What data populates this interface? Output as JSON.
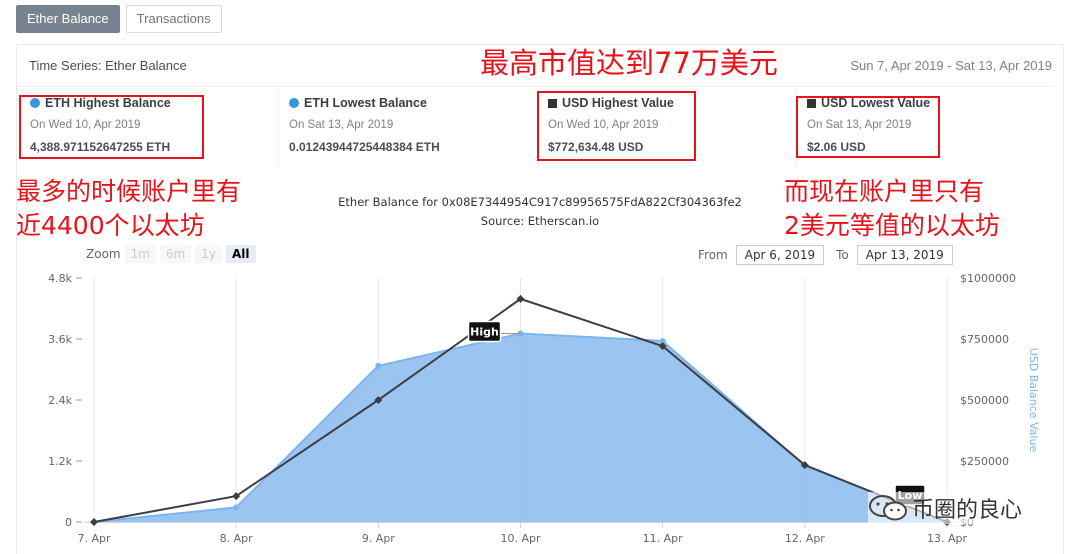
{
  "tabs": [
    {
      "label": "Ether Balance",
      "active": true
    },
    {
      "label": "Transactions",
      "active": false
    }
  ],
  "header": {
    "title": "Time Series: Ether Balance",
    "date_range": "Sun 7, Apr 2019 - Sat 13, Apr 2019"
  },
  "stats": [
    {
      "title": "ETH Highest Balance",
      "date": "On Wed 10, Apr 2019",
      "value": "4,388.971152647255 ETH",
      "marker": "dot"
    },
    {
      "title": "ETH Lowest Balance",
      "date": "On Sat 13, Apr 2019",
      "value": "0.01243944725448384 ETH",
      "marker": "dot"
    },
    {
      "title": "USD Highest Value",
      "date": "On Wed 10, Apr 2019",
      "value": "$772,634.48 USD",
      "marker": "square"
    },
    {
      "title": "USD Lowest Value",
      "date": "On Sat 13, Apr 2019",
      "value": "$2.06 USD",
      "marker": "square"
    }
  ],
  "annotations": {
    "headline": "最高市值达到77万美元",
    "left_line1": "最多的时候账户里有",
    "left_line2": "近4400个以太坊",
    "right_line1": "而现在账户里只有",
    "right_line2": "2美元等值的以太坊"
  },
  "controls": {
    "zoom_label": "Zoom",
    "zoom_options": [
      "1m",
      "6m",
      "1y",
      "All"
    ],
    "zoom_selected": "All",
    "from_label": "From",
    "from_value": "Apr 6, 2019",
    "to_label": "To",
    "to_value": "Apr 13, 2019"
  },
  "watermark": "币圈的良心",
  "chart_data": {
    "type": "area",
    "title": "Ether Balance for 0x08E7344954C917c89956575FdA822Cf304363fe2",
    "subtitle": "Source: Etherscan.io",
    "categories": [
      "7. Apr",
      "8. Apr",
      "9. Apr",
      "10. Apr",
      "11. Apr",
      "12. Apr",
      "13. Apr"
    ],
    "series": [
      {
        "values": [
          0,
          510,
          2400,
          4389,
          3460,
          1120,
          0
        ],
        "axis": "left",
        "style": "line",
        "color": "#3d3d45"
      },
      {
        "values": [
          0,
          60000,
          640000,
          772634,
          742000,
          230000,
          2.06
        ],
        "axis": "right",
        "style": "area",
        "color": "#7cb5ec"
      }
    ],
    "left_axis": {
      "ticks": [
        "0",
        "1.2k",
        "2.4k",
        "3.6k",
        "4.8k"
      ],
      "min": 0,
      "max": 4800
    },
    "right_axis": {
      "label": "USD Balance Value",
      "ticks": [
        "$0",
        "$250000",
        "$500000",
        "$750000",
        "$1000000"
      ],
      "min": 0,
      "max": 1000000
    },
    "flags": {
      "high": "High",
      "low": "Low"
    },
    "grid": "vertical"
  },
  "colors": {
    "annotation_red": "#e8131a",
    "area_fill": "#90bfee",
    "area_stroke": "#7cb5ec",
    "line": "#3d3d45",
    "tab_active_bg": "#77838f",
    "stat_dot": "#3498db"
  }
}
